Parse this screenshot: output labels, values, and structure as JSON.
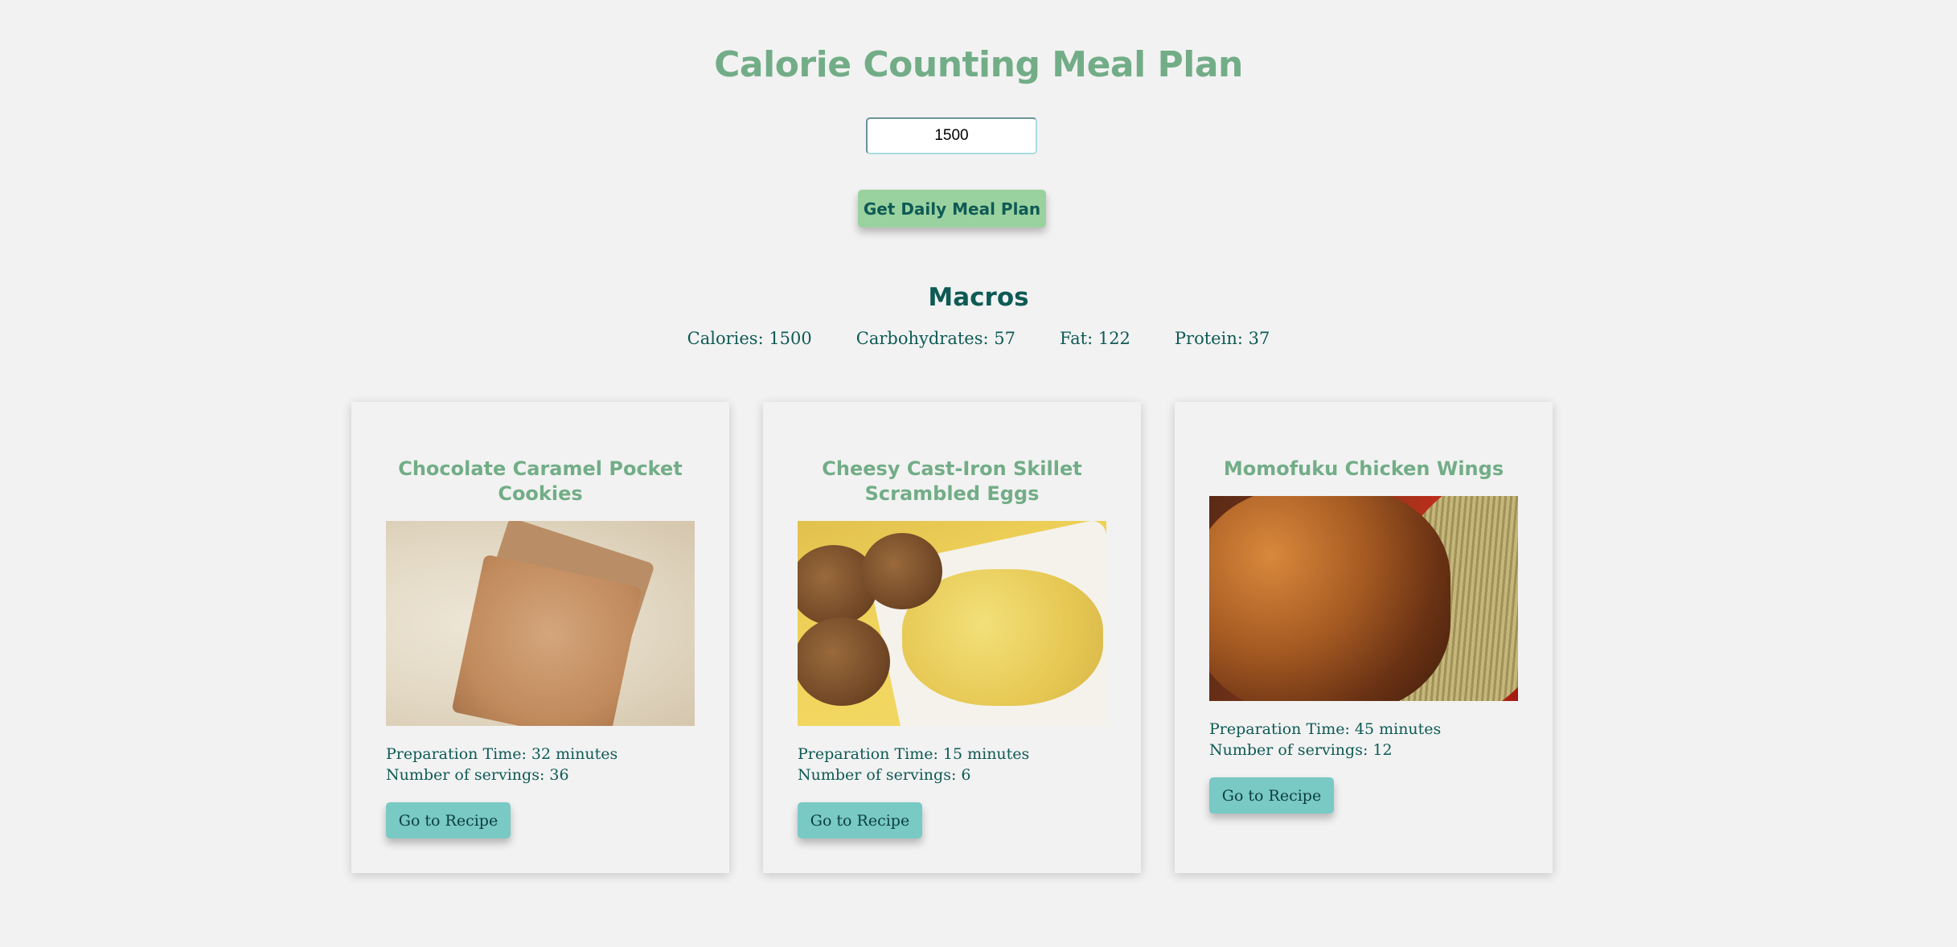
{
  "header": {
    "title": "Calorie Counting Meal Plan"
  },
  "form": {
    "calories_value": "1500",
    "submit_label": "Get Daily Meal Plan"
  },
  "macros": {
    "title": "Macros",
    "calories": "Calories: 1500",
    "carbohydrates": "Carbohydrates: 57",
    "fat": "Fat: 122",
    "protein": "Protein: 37"
  },
  "meals": [
    {
      "title": "Chocolate Caramel Pocket Cookies",
      "image_alt": "cookies-photo",
      "prep_time": "Preparation Time: 32 minutes",
      "servings": "Number of servings: 36",
      "button_label": "Go to Recipe"
    },
    {
      "title": "Cheesy Cast-Iron Skillet Scrambled Eggs",
      "image_alt": "scrambled-eggs-photo",
      "prep_time": "Preparation Time: 15 minutes",
      "servings": "Number of servings: 6",
      "button_label": "Go to Recipe"
    },
    {
      "title": "Momofuku Chicken Wings",
      "image_alt": "chicken-wings-photo",
      "prep_time": "Preparation Time: 45 minutes",
      "servings": "Number of servings: 12",
      "button_label": "Go to Recipe"
    }
  ],
  "colors": {
    "background": "#f2f2f2",
    "title_green": "#72ad87",
    "dark_teal": "#0e5a55",
    "button_green": "#9ad29f",
    "button_teal": "#79c9c5"
  }
}
